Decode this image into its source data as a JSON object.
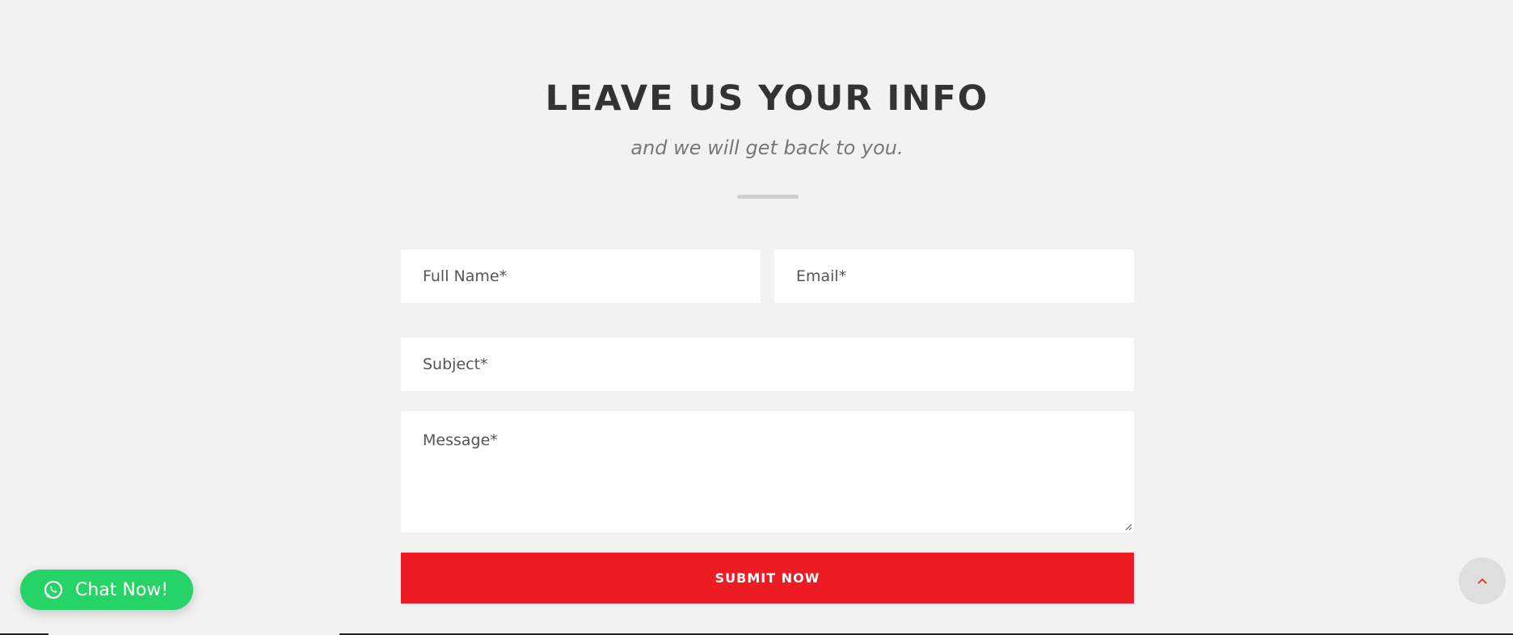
{
  "section": {
    "title": "LEAVE US YOUR INFO",
    "subtitle": "and we will get back to you."
  },
  "form": {
    "full_name_placeholder": "Full Name*",
    "email_placeholder": "Email*",
    "subject_placeholder": "Subject*",
    "message_placeholder": "Message*",
    "submit_label": "SUBMIT NOW"
  },
  "chat_widget": {
    "label": "Chat Now!",
    "icon": "whatsapp-icon"
  },
  "scroll_top": {
    "icon": "chevron-up-icon"
  },
  "colors": {
    "background": "#f2f2f2",
    "accent": "#ed1c24",
    "chat_green": "#25d366",
    "heading": "#333333"
  }
}
